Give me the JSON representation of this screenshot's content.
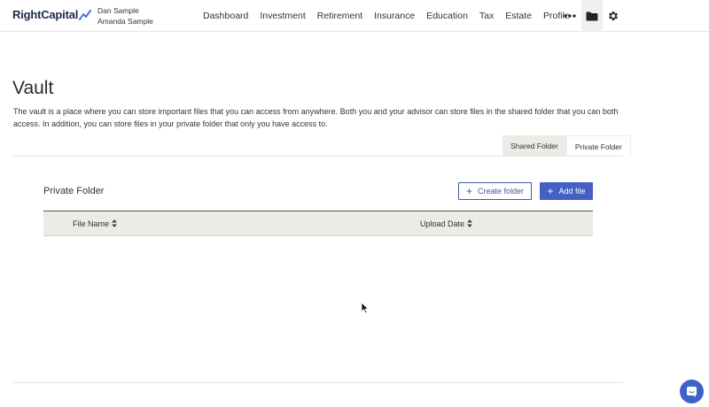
{
  "header": {
    "logo_text": "RightCapital",
    "users": [
      "Dan Sample",
      "Amanda Sample"
    ],
    "nav": [
      "Dashboard",
      "Investment",
      "Retirement",
      "Insurance",
      "Education",
      "Tax",
      "Estate",
      "Profile"
    ],
    "icons": {
      "more": "more-dots-icon",
      "vault": "folder-icon",
      "settings": "gear-icon"
    }
  },
  "page": {
    "title": "Vault",
    "description": "The vault is a place where you can store important files that you can access from anywhere. Both you and your advisor can store files in the shared folder that you can both access. In addition, you can store files in your private folder that only you have access to."
  },
  "tabs": [
    {
      "label": "Shared Folder",
      "active": false
    },
    {
      "label": "Private Folder",
      "active": true
    }
  ],
  "panel": {
    "title": "Private Folder",
    "create_folder_label": "Create folder",
    "add_file_label": "Add file"
  },
  "table": {
    "columns": [
      "File Name",
      "Upload Date"
    ],
    "rows": []
  },
  "colors": {
    "accent": "#4460c2",
    "brand_dark": "#1c2a4a",
    "header_bg": "#ecebe6"
  }
}
